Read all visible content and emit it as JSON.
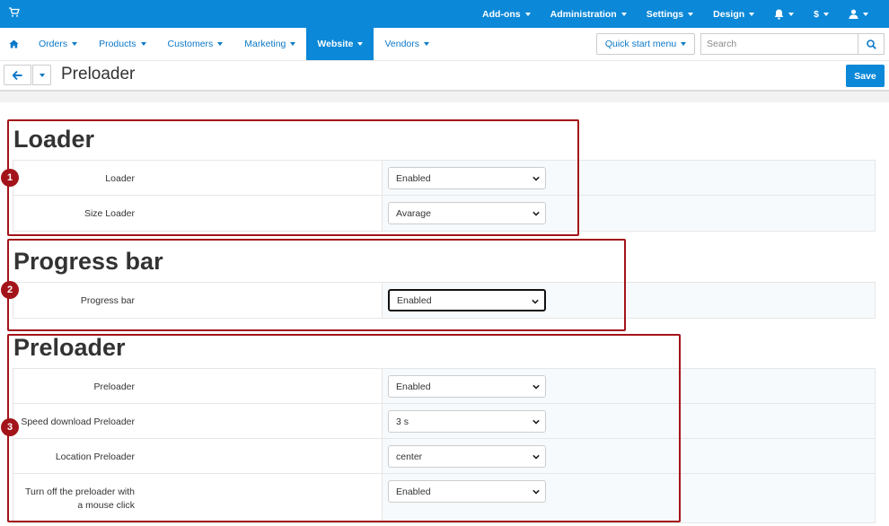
{
  "topbar": {
    "cart_icon": "cart-icon",
    "menu": [
      {
        "label": "Add-ons"
      },
      {
        "label": "Administration"
      },
      {
        "label": "Settings"
      },
      {
        "label": "Design"
      },
      {
        "icon": "bell-icon"
      },
      {
        "label": "$"
      },
      {
        "icon": "user-icon"
      }
    ]
  },
  "nav": {
    "home_icon": "home-icon",
    "items": [
      "Orders",
      "Products",
      "Customers",
      "Marketing",
      "Website",
      "Vendors"
    ],
    "active": "Website",
    "quick_start": "Quick start menu",
    "search_placeholder": "Search"
  },
  "toolbar": {
    "title": "Preloader",
    "save_label": "Save"
  },
  "sections": [
    {
      "title": "Loader",
      "badge": "1",
      "rows": [
        {
          "label": "Loader",
          "value": "Enabled"
        },
        {
          "label": "Size Loader",
          "value": "Avarage"
        }
      ]
    },
    {
      "title": "Progress bar",
      "badge": "2",
      "rows": [
        {
          "label": "Progress bar",
          "value": "Enabled"
        }
      ]
    },
    {
      "title": "Preloader",
      "badge": "3",
      "rows": [
        {
          "label": "Preloader",
          "value": "Enabled"
        },
        {
          "label": "Speed download Preloader",
          "value": "3 s"
        },
        {
          "label": "Location Preloader",
          "value": "center"
        },
        {
          "label": "Turn off the preloader with",
          "label2": "a mouse click",
          "value": "Enabled"
        }
      ]
    }
  ],
  "colors": {
    "primary": "#0b88d8",
    "annotation": "#a3141a"
  }
}
